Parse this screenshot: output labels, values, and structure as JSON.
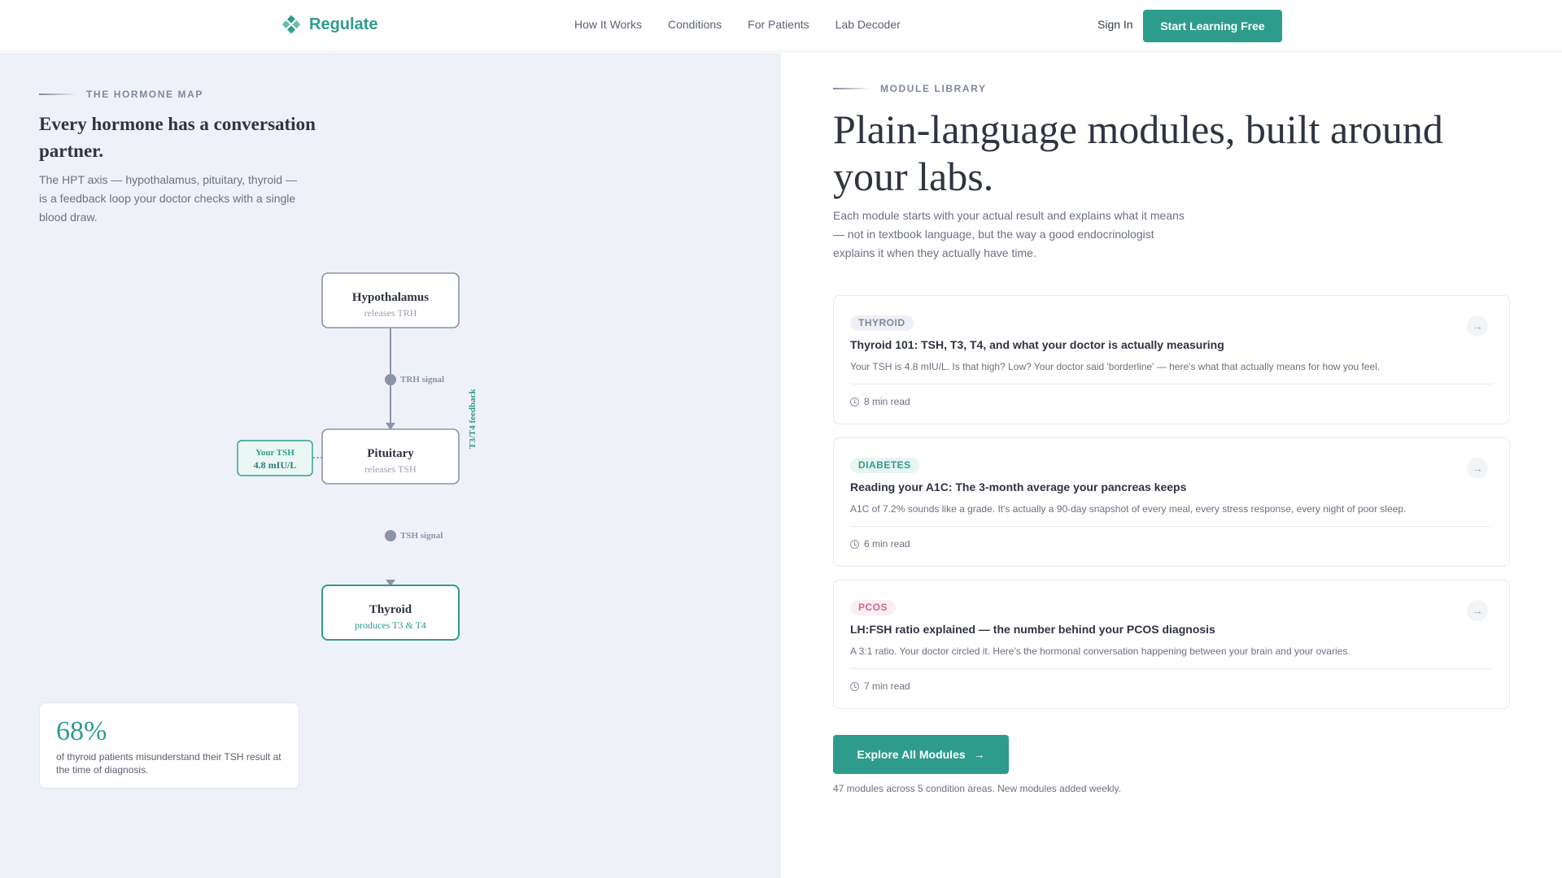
{
  "nav": {
    "brand": "Regulate",
    "links": [
      "How It Works",
      "Conditions",
      "For Patients",
      "Lab Decoder"
    ],
    "sign_in": "Sign In",
    "cta": "Start Learning Free"
  },
  "hormone_map": {
    "eyebrow": "THE HORMONE MAP",
    "title": "Every hormone has a conversation partner.",
    "body": "The HPT axis — hypothalamus, pituitary, thyroid — is a feedback loop your doctor checks with a single blood draw.",
    "nodes": [
      {
        "name": "Hypothalamus",
        "sub": "releases TRH"
      },
      {
        "name": "Pituitary",
        "sub": "releases TSH"
      },
      {
        "name": "Thyroid",
        "sub": "produces T3 & T4"
      }
    ],
    "signals": [
      "TRH signal",
      "TSH signal"
    ],
    "feedback_label": "T3/T4 feedback",
    "tsh_callout": {
      "label": "Your TSH",
      "value": "4.8 mIU/L"
    },
    "stat": {
      "value": "68%",
      "text": "of thyroid patients misunderstand their TSH result at the time of diagnosis."
    }
  },
  "library": {
    "eyebrow": "MODULE LIBRARY",
    "title": "Plain-language modules, built around your labs.",
    "body": "Each module starts with your actual result and explains what it means — not in textbook language, but the way a good endocrinologist explains it when they actually have time.",
    "modules": [
      {
        "tag": "THYROID",
        "title": "Thyroid 101: TSH, T3, T4, and what your doctor is actually measuring",
        "desc": "Your TSH is 4.8 mIU/L. Is that high? Low? Your doctor said 'borderline' — here's what that actually means for how you feel.",
        "read": "8 min read"
      },
      {
        "tag": "DIABETES",
        "title": "Reading your A1C: The 3-month average your pancreas keeps",
        "desc": "A1C of 7.2% sounds like a grade. It's actually a 90-day snapshot of every meal, every stress response, every night of poor sleep.",
        "read": "6 min read"
      },
      {
        "tag": "PCOS",
        "title": "LH:FSH ratio explained — the number behind your PCOS diagnosis",
        "desc": "A 3:1 ratio. Your doctor circled it. Here's the hormonal conversation happening between your brain and your ovaries.",
        "read": "7 min read"
      }
    ],
    "cta": "Explore All Modules",
    "note": "47 modules across 5 condition areas. New modules added weekly."
  },
  "colors": {
    "accent": "#2e9c8c",
    "left_bg": "#eff1f8",
    "thyroid_tag": "#7f8799",
    "diabetes_tag": "#2e9c8c",
    "pcos_tag": "#d06a86"
  },
  "icons": {
    "brand": "diamond-logo-icon",
    "card_arrow": "arrow-right-icon",
    "read_time": "clock-icon",
    "cta_arrow": "arrow-right-icon"
  }
}
